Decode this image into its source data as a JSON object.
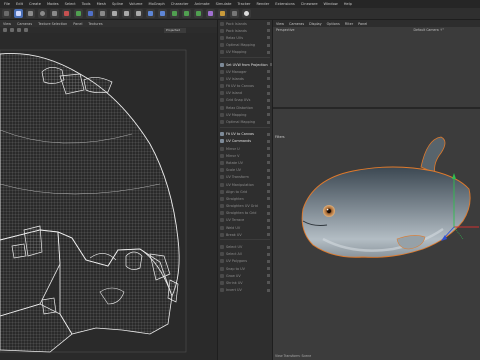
{
  "menubar": {
    "items": [
      "File",
      "Edit",
      "Create",
      "Modes",
      "Select",
      "Tools",
      "Mesh",
      "Spline",
      "Volume",
      "MoGraph",
      "Character",
      "Animate",
      "Simulate",
      "Tracker",
      "Render",
      "Extensions",
      "Cineware",
      "Window",
      "Help"
    ]
  },
  "uv_editor": {
    "subbar": [
      "View",
      "Cameras",
      "Texture Selection",
      "Panel",
      "Textures"
    ],
    "projection_value": "Projected"
  },
  "commands": [
    {
      "label": "Pack Islands",
      "hl": false
    },
    {
      "label": "Pack Islands",
      "hl": false
    },
    {
      "label": "Relax UVs",
      "hl": false
    },
    {
      "label": "Optimal Mapping",
      "hl": false
    },
    {
      "label": "UV Mapping",
      "hl": false
    },
    {
      "label": "Set UVW from Projection",
      "hl": true
    },
    {
      "label": "UV Manager",
      "hl": false
    },
    {
      "label": "UV Islands",
      "hl": false
    },
    {
      "label": "Fit UV to Canvas",
      "hl": false
    },
    {
      "label": "UV Island",
      "hl": false
    },
    {
      "label": "Grid Snap UVs",
      "hl": false
    },
    {
      "label": "Relax Distortion",
      "hl": false
    },
    {
      "label": "UV Mapping",
      "hl": false
    },
    {
      "label": "Optimal Mapping",
      "hl": false
    },
    {
      "label": "Fit UV to Canvas",
      "hl": true
    },
    {
      "label": "UV Commands",
      "hl": true
    },
    {
      "label": "Mirror U",
      "hl": false
    },
    {
      "label": "Mirror V",
      "hl": false
    },
    {
      "label": "Rotate UV",
      "hl": false
    },
    {
      "label": "Scale UV",
      "hl": false
    },
    {
      "label": "UV Transform",
      "hl": false
    },
    {
      "label": "UV Manipulation",
      "hl": false
    },
    {
      "label": "Align to Grid",
      "hl": false
    },
    {
      "label": "Straighten",
      "hl": false
    },
    {
      "label": "Straighten UV Grid",
      "hl": false
    },
    {
      "label": "Straighten to Grid",
      "hl": false
    },
    {
      "label": "UV Terrace",
      "hl": false
    },
    {
      "label": "Weld UV",
      "hl": false
    },
    {
      "label": "Break UV",
      "hl": false
    },
    {
      "label": "Select UV",
      "hl": false
    },
    {
      "label": "Select All",
      "hl": false
    },
    {
      "label": "UV Polygons",
      "hl": false
    },
    {
      "label": "Snap to UV",
      "hl": false
    },
    {
      "label": "Grow UV",
      "hl": false
    },
    {
      "label": "Shrink UV",
      "hl": false
    },
    {
      "label": "Invert UV",
      "hl": false
    }
  ],
  "viewport": {
    "menu": [
      "View",
      "Cameras",
      "Display",
      "Options",
      "Filter",
      "Panel"
    ],
    "perspective_label": "Perspective",
    "camera_label": "Default Camera ↑°",
    "filters_label": "Filters",
    "view_transform": "View Transform: Scene"
  },
  "colors": {
    "accent": "#5b7fbf",
    "wire": "#e6e6e6",
    "fish_outline": "#e07a2b"
  }
}
